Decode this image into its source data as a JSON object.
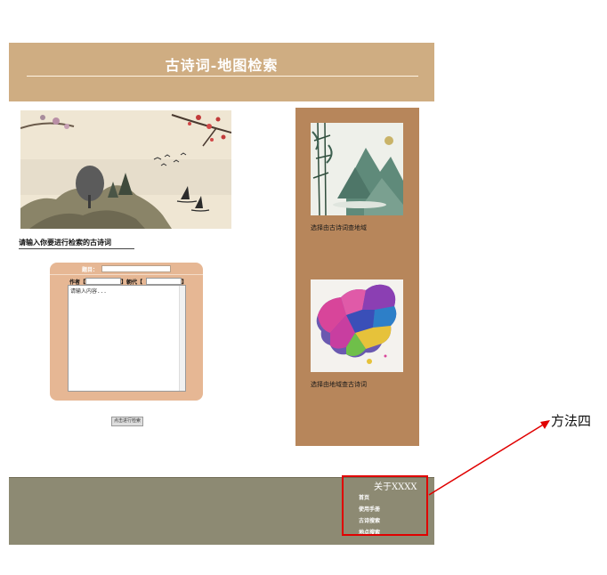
{
  "header": {
    "title": "古诗词-地图检索"
  },
  "search": {
    "prompt": "请输入你要进行检索的古诗词",
    "title_label": "题目：",
    "author_label": "作者【",
    "author_close": "】",
    "dynasty_label": "朝代【",
    "dynasty_close": "】",
    "content_placeholder": "请输入内容...",
    "submit_label": "点击进行检索"
  },
  "side": {
    "poem_to_place": "选择由古诗词查地域",
    "place_to_poem": "选择由地域查古诗词"
  },
  "footer": {
    "about": "关于XXXX",
    "links": [
      "首页",
      "使用手册",
      "古诗搜索",
      "地点搜索"
    ]
  },
  "annotation": {
    "label": "方法四",
    "color": "#e00000"
  }
}
